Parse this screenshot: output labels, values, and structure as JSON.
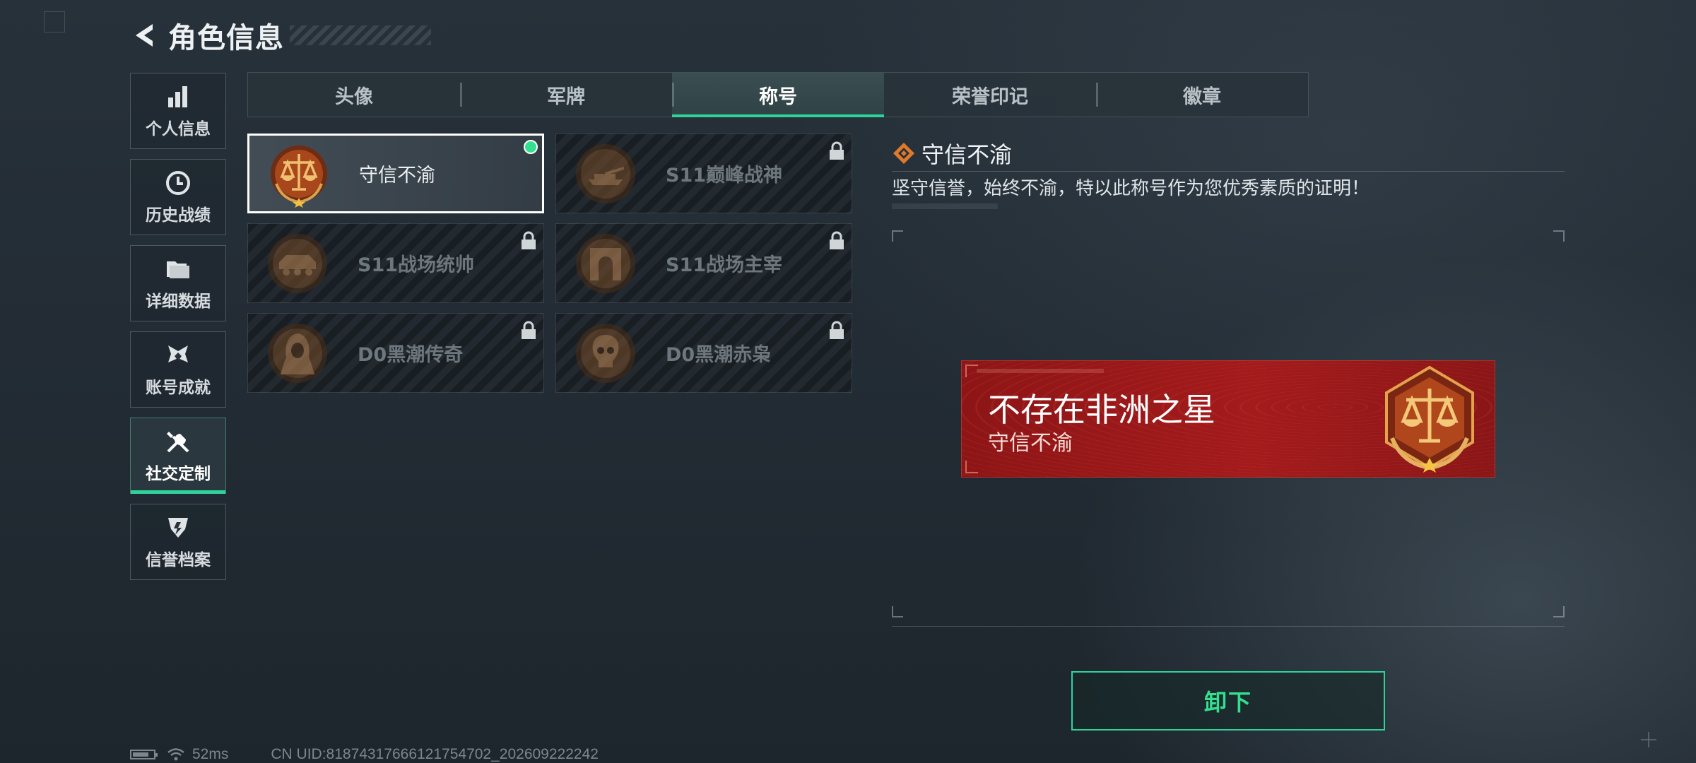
{
  "header": {
    "title": "角色信息"
  },
  "sidebar": {
    "items": [
      {
        "label": "个人信息",
        "icon": "bar-chart-icon",
        "active": false
      },
      {
        "label": "历史战绩",
        "icon": "clock-icon",
        "active": false
      },
      {
        "label": "详细数据",
        "icon": "folder-icon",
        "active": false
      },
      {
        "label": "账号成就",
        "icon": "achievement-icon",
        "active": false
      },
      {
        "label": "社交定制",
        "icon": "tools-icon",
        "active": true
      },
      {
        "label": "信誉档案",
        "icon": "shield-icon",
        "active": false
      }
    ]
  },
  "tabs": [
    {
      "label": "头像",
      "active": false
    },
    {
      "label": "军牌",
      "active": false
    },
    {
      "label": "称号",
      "active": true
    },
    {
      "label": "荣誉印记",
      "active": false
    },
    {
      "label": "徽章",
      "active": false
    }
  ],
  "titles": [
    {
      "name": "守信不渝",
      "locked": false,
      "selected": true,
      "equipped": true,
      "icon": "scales-medal-icon"
    },
    {
      "name": "S11巅峰战神",
      "locked": true,
      "selected": false,
      "equipped": false,
      "icon": "tank-medal-icon"
    },
    {
      "name": "S11战场统帅",
      "locked": true,
      "selected": false,
      "equipped": false,
      "icon": "apc-medal-icon"
    },
    {
      "name": "S11战场主宰",
      "locked": true,
      "selected": false,
      "equipped": false,
      "icon": "arch-medal-icon"
    },
    {
      "name": "D0黑潮传奇",
      "locked": true,
      "selected": false,
      "equipped": false,
      "icon": "hooded-figure-medal-icon"
    },
    {
      "name": "D0黑潮赤枭",
      "locked": true,
      "selected": false,
      "equipped": false,
      "icon": "skull-medal-icon"
    }
  ],
  "detail": {
    "title": "守信不渝",
    "description": "坚守信誉，始终不渝，特以此称号作为您优秀素质的证明！",
    "banner": {
      "player_name": "不存在非洲之星",
      "title": "守信不渝"
    },
    "unequip_label": "卸下"
  },
  "status": {
    "ping": "52ms",
    "uid": "CN UID:818743176661217547​02_202609222242"
  },
  "colors": {
    "accent": "#2fd39a",
    "banner_red": "#a41b1c",
    "medal_bronze": "#b5763f"
  }
}
